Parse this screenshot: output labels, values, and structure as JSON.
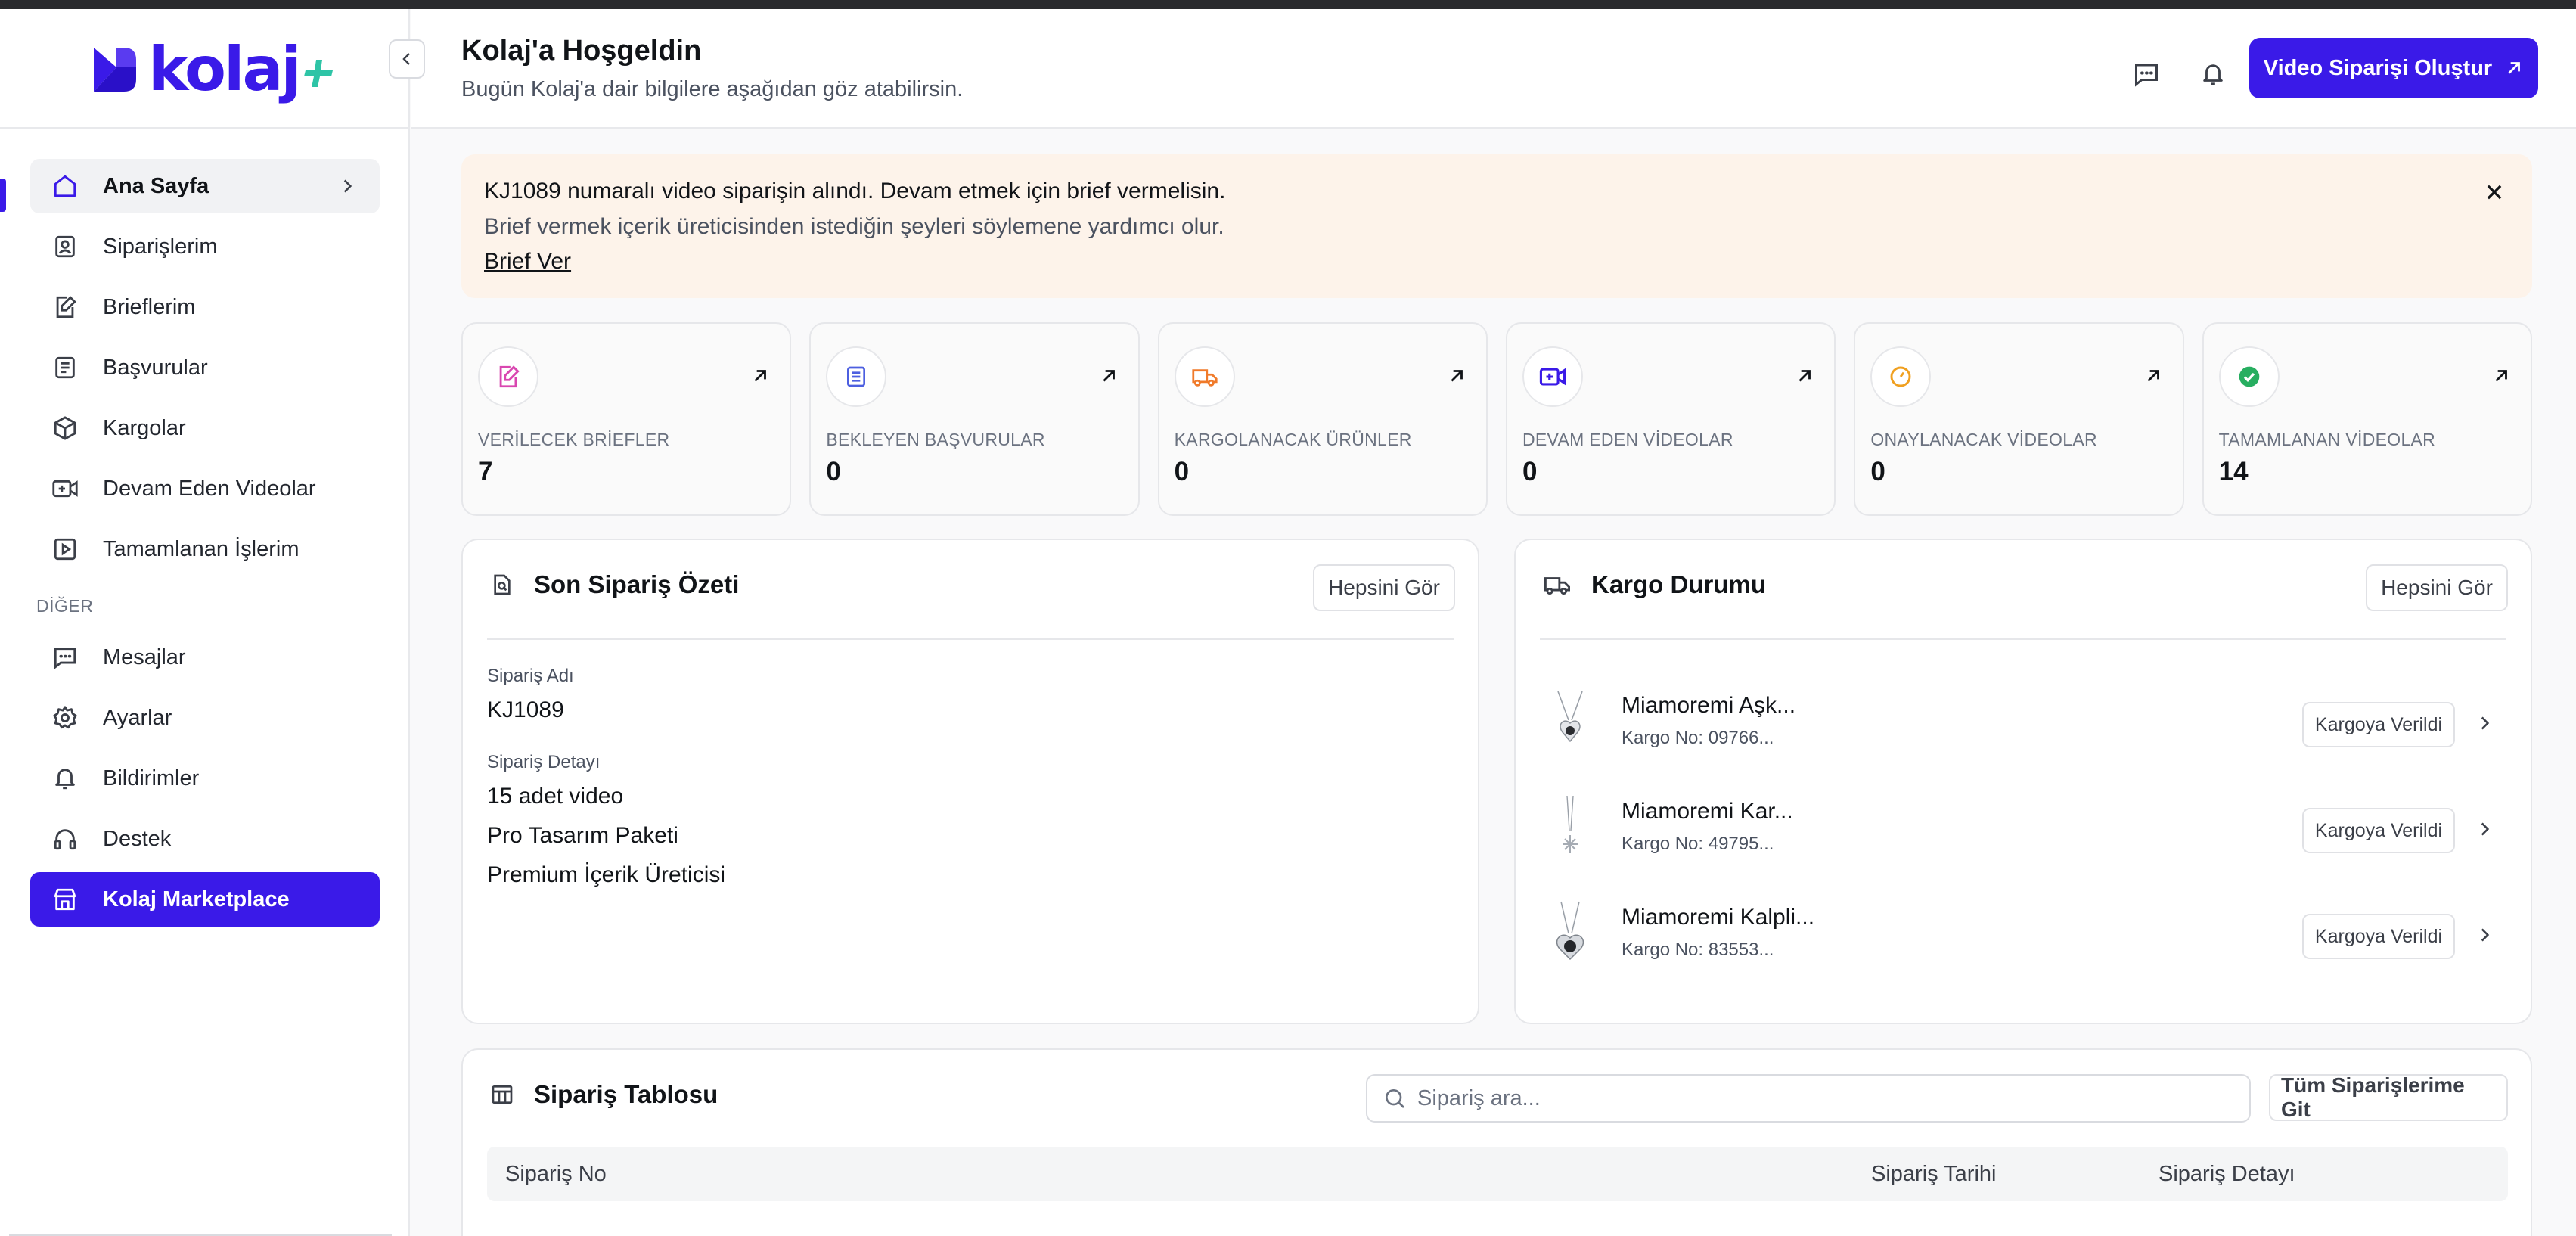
{
  "brand": {
    "name": "kolaj",
    "accent": "#3a1ae8",
    "accent2": "#2ec4a6"
  },
  "sidebar": {
    "items": [
      {
        "label": "Ana Sayfa",
        "icon": "home-icon",
        "active": true
      },
      {
        "label": "Siparişlerim",
        "icon": "orders-icon"
      },
      {
        "label": "Brieflerim",
        "icon": "brief-icon"
      },
      {
        "label": "Başvurular",
        "icon": "document-icon"
      },
      {
        "label": "Kargolar",
        "icon": "box-icon"
      },
      {
        "label": "Devam Eden Videolar",
        "icon": "video-plus-icon"
      },
      {
        "label": "Tamamlanan İşlerim",
        "icon": "play-icon"
      }
    ],
    "section_label": "DİĞER",
    "other_items": [
      {
        "label": "Mesajlar",
        "icon": "message-icon"
      },
      {
        "label": "Ayarlar",
        "icon": "gear-icon"
      },
      {
        "label": "Bildirimler",
        "icon": "bell-icon"
      },
      {
        "label": "Destek",
        "icon": "headset-icon"
      },
      {
        "label": "Kolaj Marketplace",
        "icon": "store-icon"
      }
    ]
  },
  "header": {
    "title": "Kolaj'a Hoşgeldin",
    "subtitle": "Bugün Kolaj'a dair bilgilere aşağıdan göz atabilirsin.",
    "cta_label": "Video Siparişi Oluştur"
  },
  "alert": {
    "line1": "KJ1089 numaralı video siparişin alındı. Devam etmek için brief vermelisin.",
    "line2": "Brief vermek içerik üreticisinden istediğin şeyleri söylemene yardımcı olur.",
    "link": "Brief Ver"
  },
  "stats": [
    {
      "label": "VERİLECEK BRİEFLER",
      "value": "7",
      "icon": "brief-icon",
      "color": "#d946b0"
    },
    {
      "label": "BEKLEYEN BAŞVURULAR",
      "value": "0",
      "icon": "document-icon",
      "color": "#4c5fe0"
    },
    {
      "label": "KARGOLANACAK ÜRÜNLER",
      "value": "0",
      "icon": "truck-icon",
      "color": "#f07a2a"
    },
    {
      "label": "DEVAM EDEN VİDEOLAR",
      "value": "0",
      "icon": "video-plus-icon",
      "color": "#3a1ae8"
    },
    {
      "label": "ONAYLANACAK VİDEOLAR",
      "value": "0",
      "icon": "clock-icon",
      "color": "#f0a020"
    },
    {
      "label": "TAMAMLANAN VİDEOLAR",
      "value": "14",
      "icon": "check-circle-icon",
      "color": "#27ae60"
    }
  ],
  "order_summary": {
    "title": "Son Sipariş Özeti",
    "see_all": "Hepsini Gör",
    "name_label": "Sipariş Adı",
    "name_value": "KJ1089",
    "detail_label": "Sipariş Detayı",
    "details": [
      "15 adet video",
      "Pro Tasarım Paketi",
      "Premium İçerik Üreticisi"
    ]
  },
  "cargo": {
    "title": "Kargo Durumu",
    "see_all": "Hepsini Gör",
    "items": [
      {
        "name": "Miamoremi Aşk...",
        "no": "Kargo No: 09766...",
        "status": "Kargoya Verildi"
      },
      {
        "name": "Miamoremi Kar...",
        "no": "Kargo No: 49795...",
        "status": "Kargoya Verildi"
      },
      {
        "name": "Miamoremi Kalpli...",
        "no": "Kargo No: 83553...",
        "status": "Kargoya Verildi"
      }
    ]
  },
  "table": {
    "title": "Sipariş Tablosu",
    "search_placeholder": "Sipariş ara...",
    "all_orders": "Tüm Siparişlerime Git",
    "columns": [
      "Sipariş No",
      "Sipariş Tarihi",
      "Sipariş Detayı"
    ]
  }
}
